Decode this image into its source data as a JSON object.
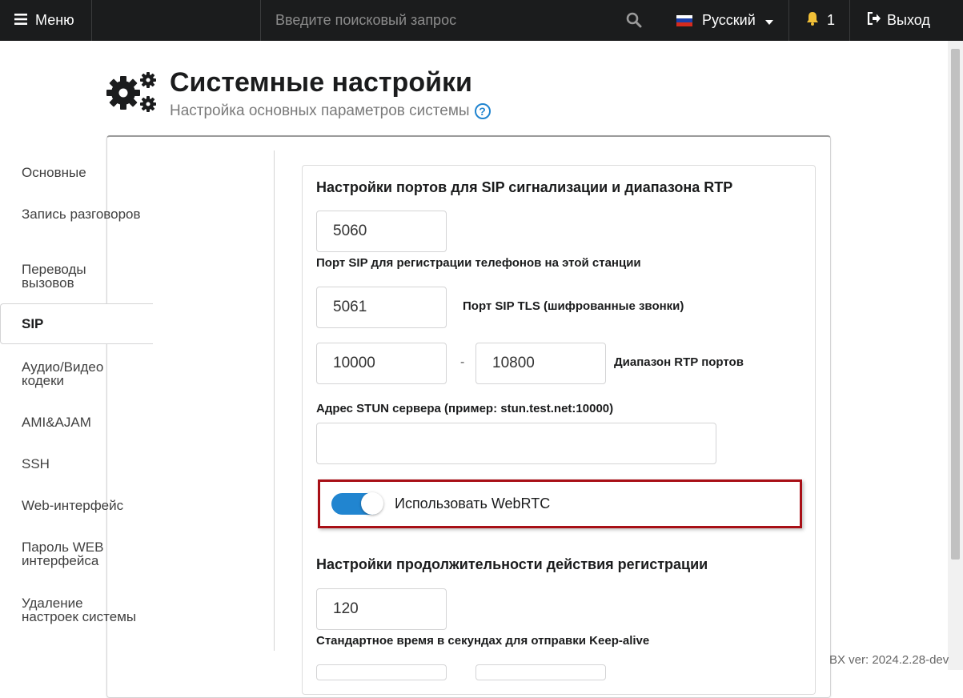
{
  "topbar": {
    "menu_label": "Меню",
    "search_placeholder": "Введите поисковый запрос",
    "language": "Русский",
    "notifications_count": "1",
    "logout_label": "Выход",
    "bg_color": "#1b1c1d"
  },
  "header": {
    "title": "Системные настройки",
    "subtitle": "Настройка основных параметров системы"
  },
  "sidebar": {
    "items": [
      {
        "label": "Основные"
      },
      {
        "label": "Запись разговоров"
      },
      {
        "label": "Переводы вызовов"
      },
      {
        "label": "SIP",
        "active": true
      },
      {
        "label": "Аудио/Видео кодеки"
      },
      {
        "label": "AMI&AJAM"
      },
      {
        "label": "SSH"
      },
      {
        "label": "Web-интерфейс"
      },
      {
        "label": "Пароль WEB интерфейса"
      },
      {
        "label": "Удаление настроек системы"
      }
    ]
  },
  "sip": {
    "ports_title": "Настройки портов для SIP сигнализации и диапазона RTP",
    "sip_port_value": "5060",
    "sip_port_label": "Порт SIP для регистрации телефонов на этой станции",
    "tls_port_value": "5061",
    "tls_port_label": "Порт SIP TLS (шифрованные звонки)",
    "rtp_start_value": "10000",
    "rtp_separator": "-",
    "rtp_end_value": "10800",
    "rtp_label": "Диапазон RTP портов",
    "stun_label": "Адрес STUN сервера (пример: stun.test.net:10000)",
    "stun_value": "",
    "webrtc_label": "Использовать WebRTC",
    "webrtc_enabled": true,
    "registration_title": "Настройки продолжительности действия регистрации",
    "keepalive_value": "120",
    "keepalive_label": "Стандартное время в секундах для отправки Keep-alive"
  },
  "footer": {
    "version": "BX ver: 2024.2.28-dev"
  },
  "colors": {
    "accent": "#2185d0",
    "highlight_border": "#a80f16"
  }
}
